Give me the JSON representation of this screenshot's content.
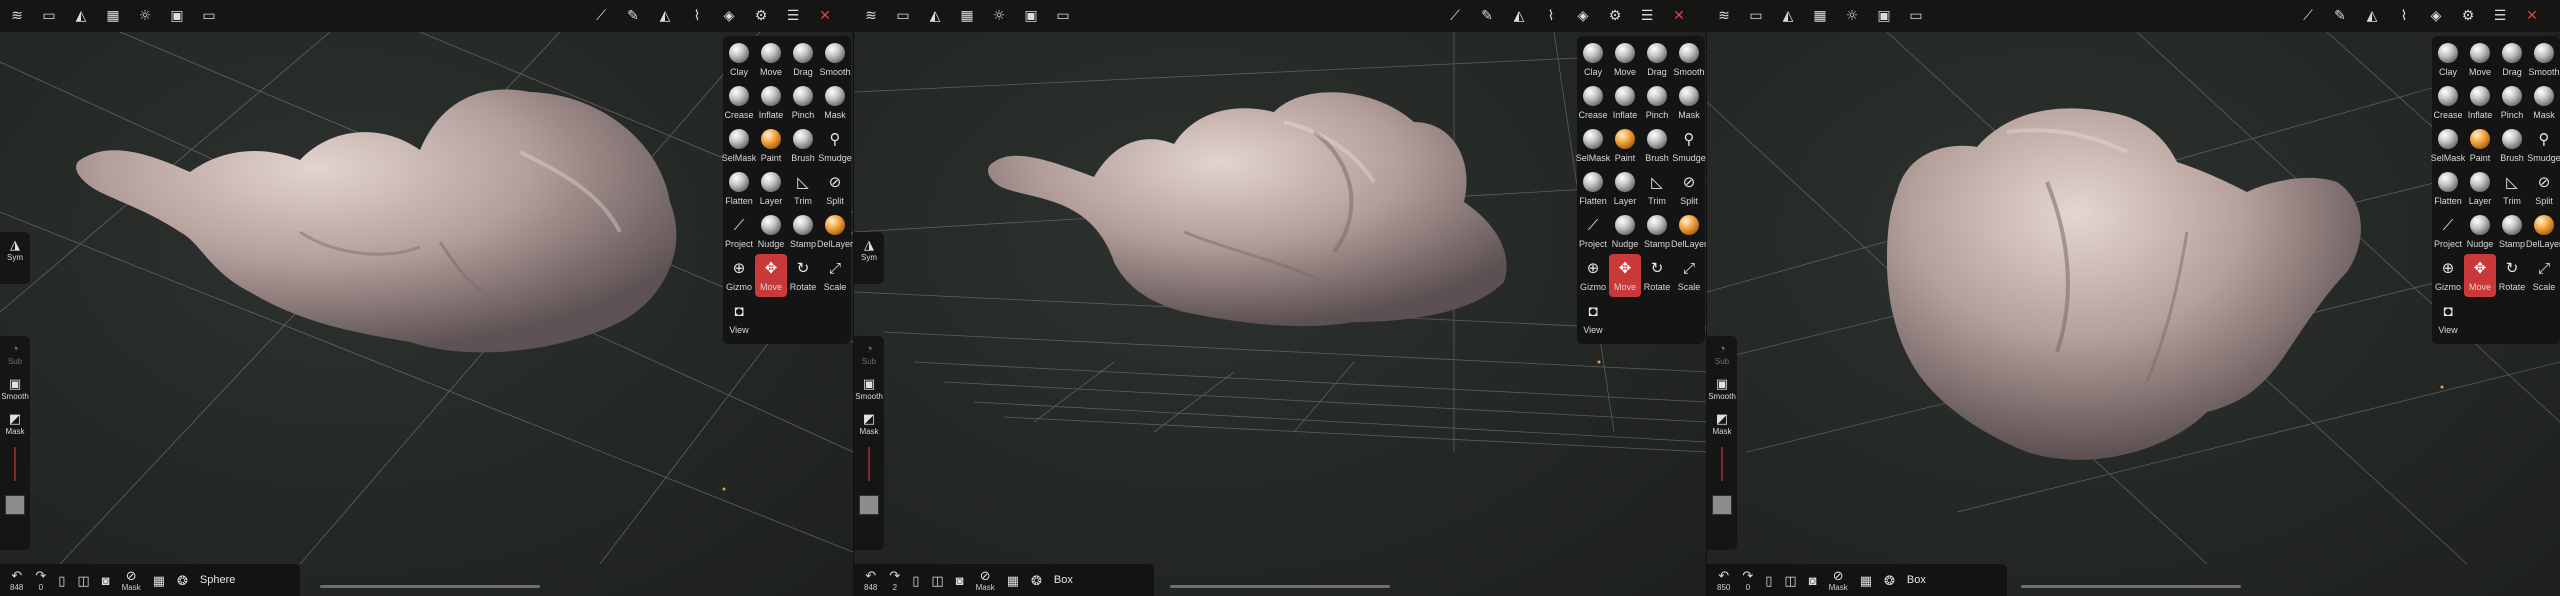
{
  "top_toolbar": {
    "left_icons": [
      "menu-icon",
      "folder-icon",
      "scene-icon",
      "grid-icon",
      "sun-icon",
      "image-icon",
      "camera-video-icon"
    ],
    "right_icons": [
      "sym-wand-icon",
      "brush-pen-icon",
      "triangle-icon",
      "smudge-icon",
      "layers-icon",
      "gear-icon",
      "sliders-icon",
      "tools-crossed-icon"
    ]
  },
  "tools": [
    {
      "label": "Clay",
      "icon": "sphere"
    },
    {
      "label": "Move",
      "icon": "sphere"
    },
    {
      "label": "Drag",
      "icon": "sphere"
    },
    {
      "label": "Smooth",
      "icon": "sphere"
    },
    {
      "label": "Crease",
      "icon": "sphere"
    },
    {
      "label": "Inflate",
      "icon": "sphere"
    },
    {
      "label": "Pinch",
      "icon": "sphere"
    },
    {
      "label": "Mask",
      "icon": "sphere"
    },
    {
      "label": "SelMask",
      "icon": "sphere"
    },
    {
      "label": "Paint",
      "icon": "sphere-orange"
    },
    {
      "label": "Brush",
      "icon": "sphere"
    },
    {
      "label": "Smudge",
      "icon": "smudge"
    },
    {
      "label": "Flatten",
      "icon": "sphere"
    },
    {
      "label": "Layer",
      "icon": "sphere"
    },
    {
      "label": "Trim",
      "icon": "trim"
    },
    {
      "label": "Split",
      "icon": "split"
    },
    {
      "label": "Project",
      "icon": "project"
    },
    {
      "label": "Nudge",
      "icon": "sphere"
    },
    {
      "label": "Stamp",
      "icon": "sphere"
    },
    {
      "label": "DelLayer",
      "icon": "sphere-orange"
    },
    {
      "label": "Gizmo",
      "icon": "gizmo"
    },
    {
      "label": "Move",
      "icon": "move-arrows",
      "active": true
    },
    {
      "label": "Rotate",
      "icon": "rotate"
    },
    {
      "label": "Scale",
      "icon": "scale"
    },
    {
      "label": "View",
      "icon": "camera"
    }
  ],
  "left_panel": {
    "sym_label": "Sym",
    "sub_label": "Sub",
    "smooth_label": "Smooth",
    "mask_label": "Mask"
  },
  "panels": [
    {
      "undo_count": "848",
      "redo_count": "0",
      "mask_label": "Mask",
      "primitive_label": "Sphere"
    },
    {
      "undo_count": "848",
      "redo_count": "2",
      "mask_label": "Mask",
      "primitive_label": "Box"
    },
    {
      "undo_count": "850",
      "redo_count": "0",
      "mask_label": "Mask",
      "primitive_label": "Box"
    }
  ],
  "colors": {
    "background": "#262a27",
    "toolbar": "#151514",
    "active_tool": "#c9393a",
    "mesh": "#b9a6a3",
    "grid": "#9aa19c"
  }
}
